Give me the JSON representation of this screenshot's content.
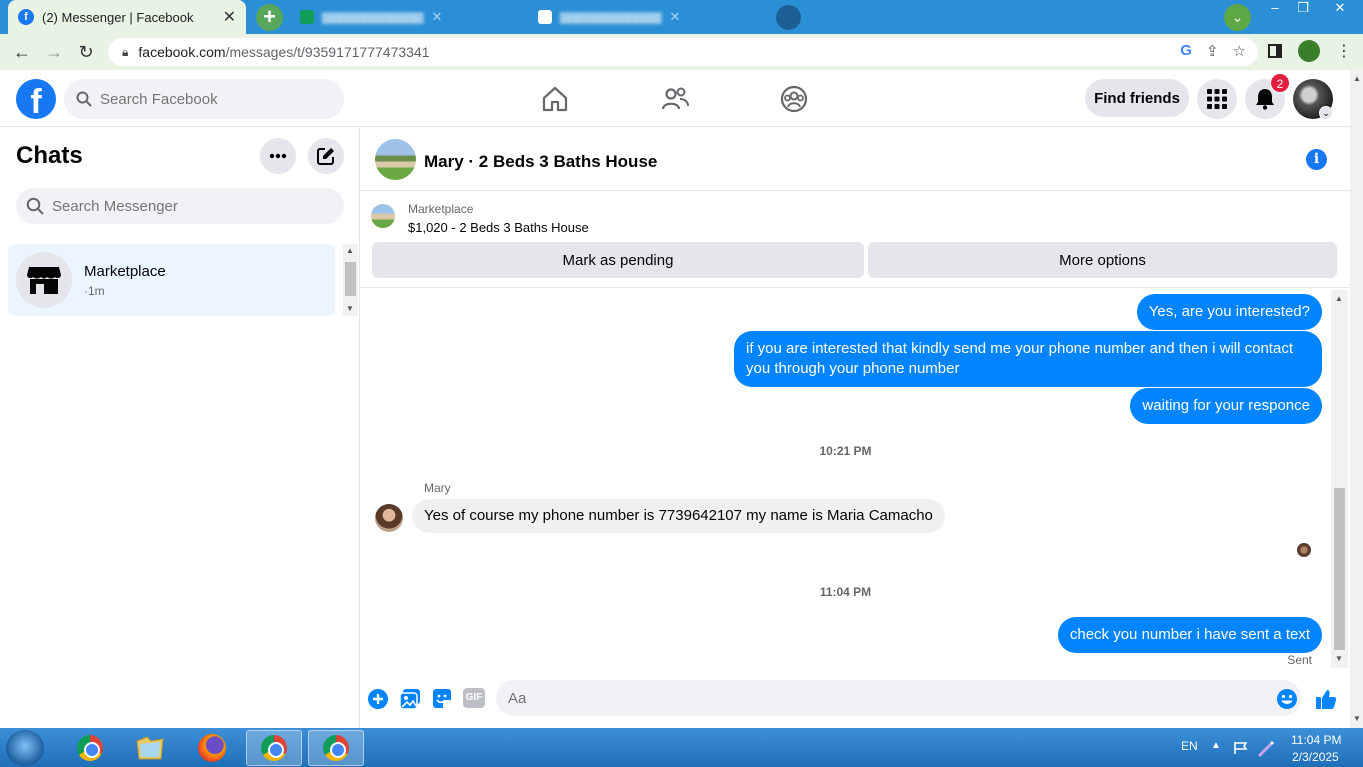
{
  "browser": {
    "active_tab_title": "(2) Messenger | Facebook",
    "url_host": "facebook.com",
    "url_path": "/messages/t/9359171777473341",
    "window_controls": [
      "‒",
      "❐",
      "✕"
    ]
  },
  "fb_header": {
    "search_placeholder": "Search Facebook",
    "find_friends_label": "Find friends",
    "notification_count": "2"
  },
  "chats": {
    "title": "Chats",
    "search_placeholder": "Search Messenger",
    "items": [
      {
        "name": "Marketplace",
        "time": "·1m"
      }
    ]
  },
  "conversation": {
    "title": "Mary · 2 Beds 3 Baths House",
    "marketplace_label": "Marketplace",
    "listing": "$1,020 - 2 Beds 3 Baths House",
    "mark_pending_label": "Mark as pending",
    "more_options_label": "More options",
    "messages_out_1": [
      "Yes, are you interested?",
      "if you are interested that kindly send me your phone number and then i will contact you through your phone number",
      "waiting for your responce"
    ],
    "timestamp_1": "10:21 PM",
    "sender_name": "Mary",
    "message_in": "Yes of course my phone number is 7739642107 my name is Maria Camacho",
    "timestamp_2": "11:04 PM",
    "message_out_2": "check you number i have sent a text",
    "sent_status": "Sent",
    "composer_placeholder": "Aa",
    "gif_label": "GIF"
  },
  "taskbar": {
    "language": "EN",
    "time": "11:04 PM",
    "date": "2/3/2025"
  },
  "colors": {
    "fb_blue": "#1877f2",
    "messenger_blue": "#0084ff",
    "badge_red": "#e41e3f"
  }
}
